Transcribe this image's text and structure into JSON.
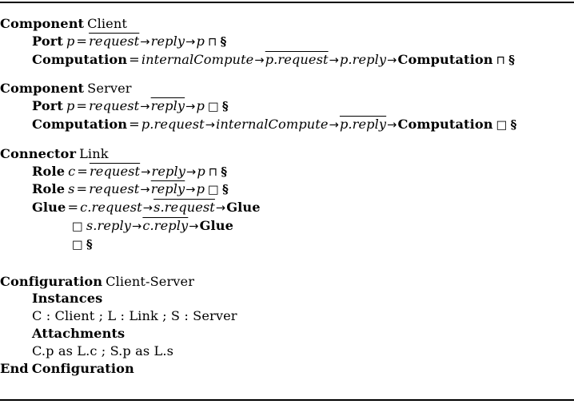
{
  "document": {
    "type": "wright-adl-specification",
    "rules": {
      "top": true,
      "bottom": true
    },
    "symbols": {
      "arrow": "→",
      "sqcap": "⊓",
      "box": "□",
      "section": "§",
      "equals": "=",
      "semicolon": ";",
      "colon": ":"
    },
    "blocks": [
      {
        "id": "component-client",
        "header": {
          "keyword": "Component",
          "name": "Client"
        },
        "lines": [
          {
            "id": "client-port",
            "indent": 1,
            "keyword": "Port",
            "lhs": "p",
            "eq": "=",
            "terms": [
              "request",
              "reply",
              "p"
            ],
            "overlined": [
              true,
              false,
              false
            ],
            "tail_op": "⊓",
            "tail": "§"
          },
          {
            "id": "client-computation",
            "indent": 1,
            "keyword": "Computation",
            "lhs": "",
            "eq": "=",
            "terms": [
              "internalCompute",
              "p.request",
              "p.reply",
              "Computation"
            ],
            "overlined": [
              false,
              true,
              false,
              false
            ],
            "tail_op": "⊓",
            "tail": "§"
          }
        ]
      },
      {
        "id": "component-server",
        "header": {
          "keyword": "Component",
          "name": "Server"
        },
        "lines": [
          {
            "id": "server-port",
            "indent": 1,
            "keyword": "Port",
            "lhs": "p",
            "eq": "=",
            "terms": [
              "request",
              "reply",
              "p"
            ],
            "overlined": [
              false,
              true,
              false
            ],
            "tail_op": "□",
            "tail": "§"
          },
          {
            "id": "server-computation",
            "indent": 1,
            "keyword": "Computation",
            "lhs": "",
            "eq": "=",
            "terms": [
              "p.request",
              "internalCompute",
              "p.reply",
              "Computation"
            ],
            "overlined": [
              false,
              false,
              true,
              false
            ],
            "tail_op": "□",
            "tail": "§"
          }
        ]
      },
      {
        "id": "connector-link",
        "header": {
          "keyword": "Connector",
          "name": "Link"
        },
        "lines": [
          {
            "id": "role-c",
            "indent": 1,
            "keyword": "Role",
            "lhs": "c",
            "eq": "=",
            "terms": [
              "request",
              "reply",
              "p"
            ],
            "overlined": [
              true,
              false,
              false
            ],
            "tail_op": "⊓",
            "tail": "§"
          },
          {
            "id": "role-s",
            "indent": 1,
            "keyword": "Role",
            "lhs": "s",
            "eq": "=",
            "terms": [
              "request",
              "reply",
              "p"
            ],
            "overlined": [
              false,
              true,
              false
            ],
            "tail_op": "□",
            "tail": "§"
          },
          {
            "id": "glue",
            "indent": 1,
            "keyword": "Glue",
            "lhs": "",
            "eq": "=",
            "terms": [
              "c.request",
              "s.request",
              "Glue"
            ],
            "overlined": [
              false,
              true,
              false
            ],
            "tail_op": "",
            "tail": ""
          },
          {
            "id": "glue-alt-1",
            "indent": 2,
            "lead_op": "□",
            "terms": [
              "s.reply",
              "c.reply",
              "Glue"
            ],
            "overlined": [
              false,
              true,
              false
            ]
          },
          {
            "id": "glue-alt-2",
            "indent": 2,
            "lead_op": "□",
            "terms": [],
            "overlined": [],
            "tail": "§"
          }
        ]
      },
      {
        "id": "configuration",
        "header": {
          "keyword": "Configuration",
          "name": "Client-Server"
        },
        "lines": [
          {
            "id": "instances-heading",
            "indent": 1,
            "heading": "Instances"
          },
          {
            "id": "instances-list",
            "indent": 1,
            "plain": "C : Client ; L : Link ; S : Server"
          },
          {
            "id": "attachments-heading",
            "indent": 1,
            "heading": "Attachments"
          },
          {
            "id": "attachments-list",
            "indent": 1,
            "plain": "C.p as L.c ; S.p as L.s"
          }
        ],
        "footer": {
          "keyword": "End",
          "name": "Configuration"
        }
      }
    ]
  },
  "text": {
    "component": "Component",
    "connector": "Connector",
    "configuration": "Configuration",
    "end": "End",
    "client": "Client",
    "server": "Server",
    "link": "Link",
    "client_server": "Client-Server",
    "port": "Port",
    "role": "Role",
    "glue": "Glue",
    "computation": "Computation",
    "instances": "Instances",
    "attachments": "Attachments",
    "instances_list": "C : Client ; L : Link ; S : Server",
    "attachments_list": "C.p as L.c ; S.p as L.s",
    "p": "p",
    "c": "c",
    "s": "s",
    "eq": "=",
    "request": "request",
    "reply": "reply",
    "internalCompute": "internalCompute",
    "p_request": "p.request",
    "p_reply": "p.reply",
    "c_request": "c.request",
    "s_request": "s.request",
    "s_reply": "s.reply",
    "c_reply": "c.reply",
    "arrow": "→",
    "sqcap": "⊓",
    "box": "□",
    "section": "§"
  }
}
